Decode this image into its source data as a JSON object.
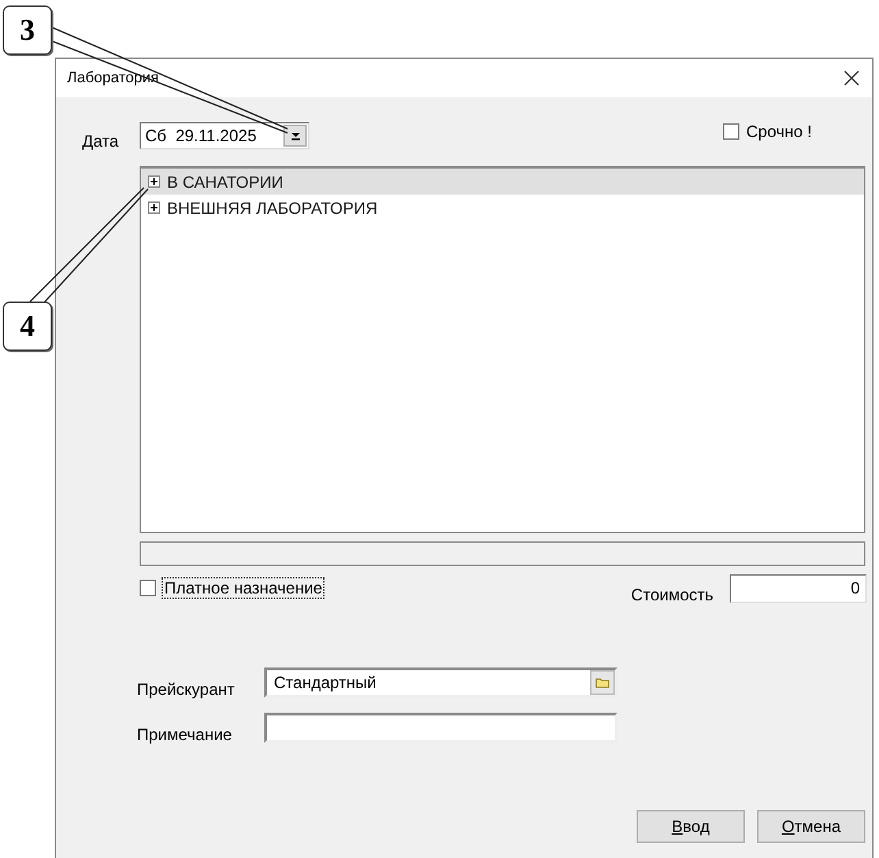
{
  "callouts": [
    {
      "label": "3"
    },
    {
      "label": "4"
    }
  ],
  "window": {
    "title": "Лаборатория"
  },
  "date": {
    "label": "Дата",
    "value": "Сб  29.11.2025"
  },
  "urgent": {
    "label": "Срочно !",
    "checked": false
  },
  "tree": {
    "items": [
      {
        "label": "В САНАТОРИИ",
        "expanded": false,
        "selected": true
      },
      {
        "label": "ВНЕШНЯЯ ЛАБОРАТОРИЯ",
        "expanded": false,
        "selected": false
      }
    ]
  },
  "paid": {
    "label": "Платное назначение",
    "checked": false
  },
  "cost": {
    "label": "Стоимость",
    "value": "0"
  },
  "price_list": {
    "label": "Прейскурант",
    "value": "Стандартный"
  },
  "note": {
    "label": "Примечание"
  },
  "buttons": [
    {
      "label": "Ввод"
    },
    {
      "label": "Отмена"
    }
  ]
}
